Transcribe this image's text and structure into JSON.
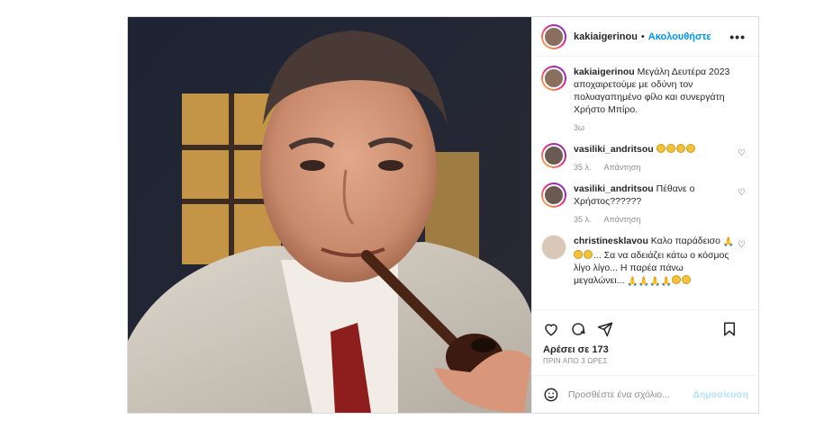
{
  "post": {
    "author": "kakiaigerinou",
    "dot": "•",
    "follow_label": "Ακολουθήστε",
    "more_label": "•••",
    "photo_alt": "photo"
  },
  "caption": {
    "username": "kakiaigerinou",
    "text": "Μεγάλη Δευτέρα 2023 αποχαιρετούμε με οδύνη τον πολυαγαπημένο φίλο και συνεργάτη Χρήστο Μπίρο.",
    "time": "3ω"
  },
  "comments": [
    {
      "username": "vasiliki_andritsou",
      "text": "",
      "time": "35 λ.",
      "reply": "Απάντηση"
    },
    {
      "username": "vasiliki_andritsou",
      "text": "Πέθανε ο Χρήστος??????",
      "time": "35 λ.",
      "reply": "Απάντηση"
    },
    {
      "username": "christinesklavou",
      "text1": "Καλο παράδεισο",
      "text2": "... Σα να αδειάζει κάτω ο κόσμος λίγο λίγο... Η παρέα πάνω μεγαλώνει..."
    }
  ],
  "likes": "Αρέσει σε 173",
  "post_time": "ΠΡΙΝ ΑΠΟ 3 ΩΡΕΣ",
  "add_comment": {
    "placeholder": "Προσθέστε ένα σχόλιο...",
    "post_label": "Δημοσίευση"
  },
  "colors": {
    "accent": "#0095f6",
    "post_disabled": "#b2dffc",
    "muted": "#8e8e8e"
  }
}
